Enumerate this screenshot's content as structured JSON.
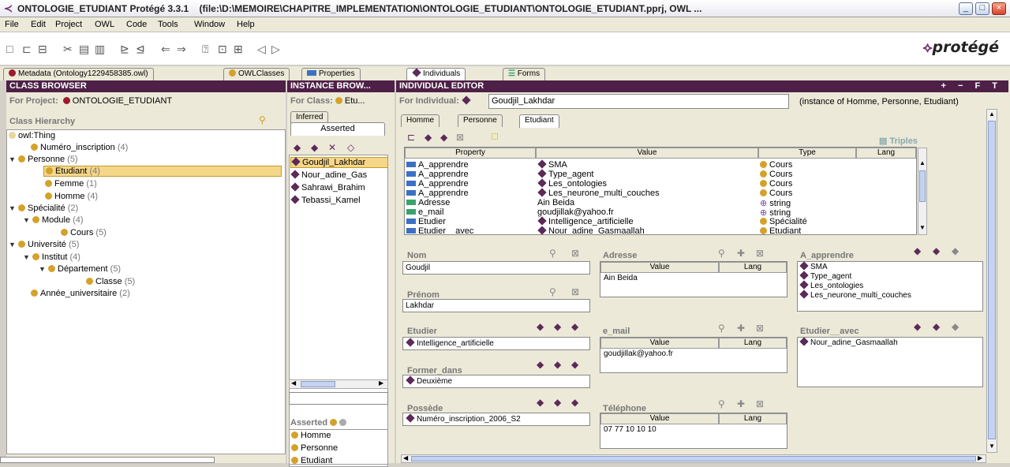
{
  "window": {
    "title": "ONTOLOGIE_ETUDIANT  Protégé 3.3.1",
    "path": "(file:\\D:\\MEMOIRE\\CHAPITRE_IMPLEMENTATION\\ONTOLOGIE_ETUDIANT\\ONTOLOGIE_ETUDIANT.pprj, OWL ..."
  },
  "menu": [
    "File",
    "Edit",
    "Project",
    "OWL",
    "Code",
    "Tools",
    "Window",
    "Help"
  ],
  "logo": "protégé",
  "tabs": [
    "Metadata (Ontology1229458385.owl)",
    "OWLClasses",
    "Properties",
    "Individuals",
    "Forms"
  ],
  "class_browser": {
    "title": "CLASS BROWSER",
    "for_project_label": "For Project:",
    "project": "ONTOLOGIE_ETUDIANT",
    "hierarchy_label": "Class Hierarchy",
    "items": [
      {
        "name": "owl:Thing",
        "count": ""
      },
      {
        "name": "Numéro_inscription",
        "count": "(4)"
      },
      {
        "name": "Personne",
        "count": "(5)"
      },
      {
        "name": "Etudiant",
        "count": "(4)"
      },
      {
        "name": "Femme",
        "count": "(1)"
      },
      {
        "name": "Homme",
        "count": "(4)"
      },
      {
        "name": "Spécialité",
        "count": "(2)"
      },
      {
        "name": "Module",
        "count": "(4)"
      },
      {
        "name": "Cours",
        "count": "(5)"
      },
      {
        "name": "Université",
        "count": "(5)"
      },
      {
        "name": "Institut",
        "count": "(4)"
      },
      {
        "name": "Département",
        "count": "(5)"
      },
      {
        "name": "Classe",
        "count": "(5)"
      },
      {
        "name": "Année_universitaire",
        "count": "(2)"
      }
    ]
  },
  "instance_browser": {
    "title": "INSTANCE BROW...",
    "for_class_label": "For Class:",
    "class_value": "Etu...",
    "tab_inferred": "Inferred",
    "tab_asserted": "Asserted",
    "instances": [
      "Goudjil_Lakhdar",
      "Nour_adine_Gas",
      "Sahrawi_Brahim",
      "Tebassi_Kamel"
    ],
    "asserted_label": "Asserted",
    "asserted_types": [
      "Homme",
      "Personne",
      "Etudiant"
    ]
  },
  "individual_editor": {
    "title": "INDIVIDUAL EDITOR",
    "header_icons": "+ − F T",
    "for_individual_label": "For Individual:",
    "individual": "Goudjil_Lakhdar",
    "instance_of": "(instance of Homme, Personne, Etudiant)",
    "tabs": [
      "Homme",
      "Personne",
      "Etudiant"
    ],
    "triples_label": "Triples",
    "columns": [
      "Property",
      "Value",
      "Type",
      "Lang"
    ],
    "rows": [
      {
        "p": "A_apprendre",
        "v": "SMA",
        "t": "Cours",
        "l": ""
      },
      {
        "p": "A_apprendre",
        "v": "Type_agent",
        "t": "Cours",
        "l": ""
      },
      {
        "p": "A_apprendre",
        "v": "Les_ontologies",
        "t": "Cours",
        "l": ""
      },
      {
        "p": "A_apprendre",
        "v": "Les_neurone_multi_couches",
        "t": "Cours",
        "l": ""
      },
      {
        "p": "Adresse",
        "v": "Ain Beida",
        "t": "string",
        "l": ""
      },
      {
        "p": "e_mail",
        "v": "goudjillak@yahoo.fr",
        "t": "string",
        "l": ""
      },
      {
        "p": "Etudier",
        "v": "Intelligence_artificielle",
        "t": "Spécialité",
        "l": ""
      },
      {
        "p": "Etudier__avec",
        "v": "Nour_adine_Gasmaallah",
        "t": "Etudiant",
        "l": ""
      }
    ],
    "nom_label": "Nom",
    "nom": "Goudjil",
    "prenom_label": "Prénom",
    "prenom": "Lakhdar",
    "etudier_label": "Etudier",
    "etudier": "Intelligence_artificielle",
    "former_label": "Former_dans",
    "former": "Deuxième",
    "possede_label": "Possède",
    "possede": "Numéro_inscription_2006_S2",
    "adresse_label": "Adresse",
    "adresse": "Ain Beida",
    "email_label": "e_mail",
    "email": "goudjillak@yahoo.fr",
    "tel_label": "Téléphone",
    "tel": "07 77 10 10 10",
    "value_col": "Value",
    "lang_col": "Lang",
    "apprendre_label": "A_apprendre",
    "apprendre": [
      "SMA",
      "Type_agent",
      "Les_ontologies",
      "Les_neurone_multi_couches"
    ],
    "avec_label": "Etudier__avec",
    "avec": "Nour_adine_Gasmaallah"
  }
}
